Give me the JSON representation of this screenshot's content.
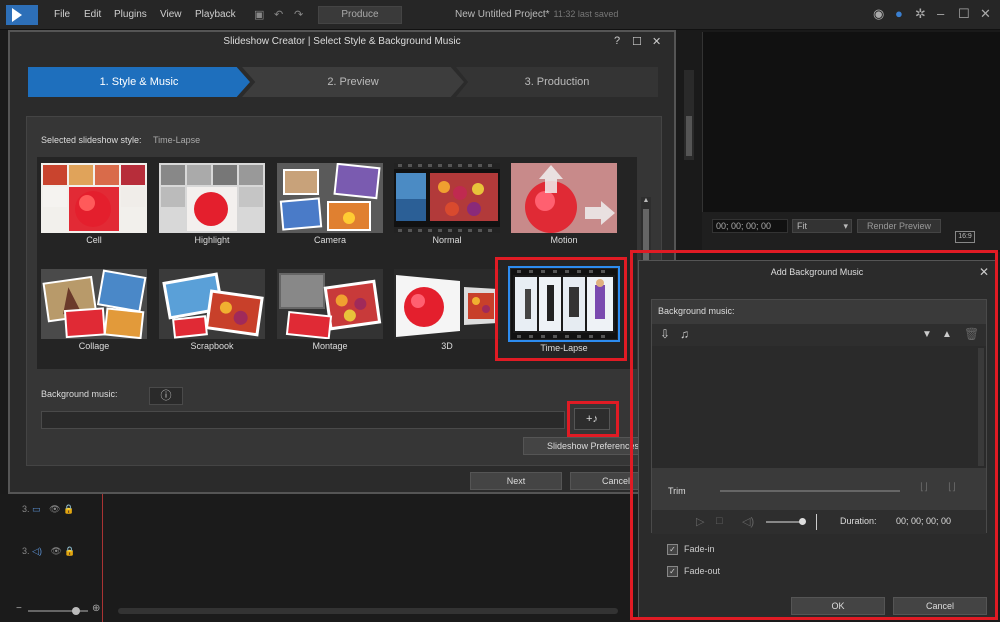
{
  "app": {
    "menu": [
      "File",
      "Edit",
      "Plugins",
      "View",
      "Playback"
    ],
    "produce_label": "Produce",
    "project_title": "New Untitled Project*",
    "saved_text": "11:32 last saved",
    "timecode": "00; 00; 00; 00",
    "fit_label": "Fit",
    "render_preview_label": "Render Preview",
    "aspect_ratio": "16:9",
    "tracks": [
      {
        "num": "3.",
        "icon": "video-track-icon"
      },
      {
        "num": "3.",
        "icon": "audio-track-icon"
      }
    ]
  },
  "slideshow": {
    "title": "Slideshow Creator | Select Style & Background Music",
    "steps": [
      "1. Style & Music",
      "2. Preview",
      "3. Production"
    ],
    "active_step": 0,
    "selected_style_label": "Selected slideshow style:",
    "selected_style_value": "Time-Lapse",
    "styles": [
      "Cell",
      "Highlight",
      "Camera",
      "Normal",
      "Motion",
      "Collage",
      "Scrapbook",
      "Montage",
      "3D",
      "Time-Lapse"
    ],
    "background_music_label": "Background music:",
    "info_glyph": "ⓘ",
    "add_music_glyph": "+♪",
    "preferences_label": "Slideshow Preferences",
    "next_label": "Next",
    "cancel_label": "Cancel"
  },
  "add_music": {
    "title": "Add Background Music",
    "bg_music_label": "Background music:",
    "trim_label": "Trim",
    "duration_label": "Duration:",
    "duration_value": "00; 00; 00; 00",
    "fade_in_label": "Fade-in",
    "fade_out_label": "Fade-out",
    "fade_in_checked": true,
    "fade_out_checked": true,
    "ok_label": "OK",
    "cancel_label": "Cancel"
  },
  "colors": {
    "accent": "#1e6fbd",
    "highlight_red": "#e01b24",
    "selection_blue": "#2d8cf0"
  }
}
